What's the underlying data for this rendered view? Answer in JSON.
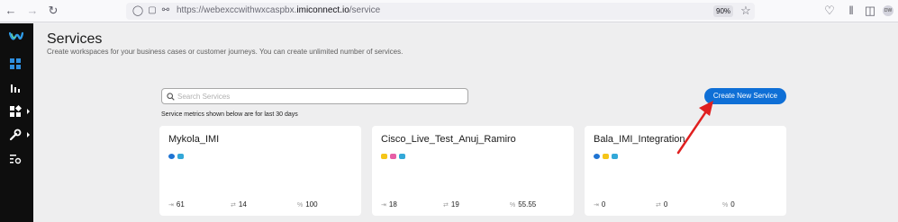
{
  "browser": {
    "url_prefix": "https://webexccwithwxcaspbx.",
    "url_domain": "imiconnect.io",
    "url_path": "/service",
    "zoom": "90%",
    "avatar_initials": "DW"
  },
  "page": {
    "title": "Services",
    "subtitle": "Create workspaces for your business cases or customer journeys. You can create unlimited number of services.",
    "search_placeholder": "Search Services",
    "metrics_note": "Service metrics shown below are for last 30 days",
    "create_button": "Create New Service"
  },
  "services": [
    {
      "name": "Mykola_IMI",
      "channels": [
        "messenger-icon",
        "chat-icon"
      ],
      "stats": [
        "61",
        "14",
        "100"
      ]
    },
    {
      "name": "Cisco_Live_Test_Anuj_Ramiro",
      "channels": [
        "sms-icon",
        "email-icon",
        "chat-icon"
      ],
      "stats": [
        "18",
        "19",
        "55.55"
      ]
    },
    {
      "name": "Bala_IMI_Integration",
      "channels": [
        "messenger-icon",
        "sms-icon",
        "chat-icon"
      ],
      "stats": [
        "0",
        "0",
        "0"
      ]
    }
  ],
  "colors": {
    "accent": "#0f6fd6",
    "annotation_arrow": "#e02020",
    "sidebar": "#0e0e0e"
  }
}
